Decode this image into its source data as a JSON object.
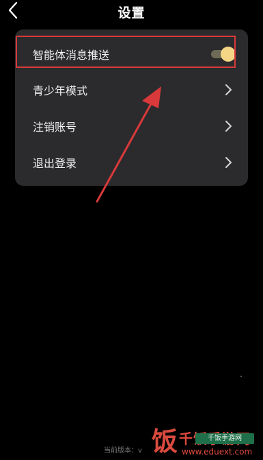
{
  "header": {
    "title": "设置"
  },
  "settings": {
    "items": [
      {
        "label": "智能体消息推送",
        "control": "toggle",
        "toggle_on": true
      },
      {
        "label": "青少年模式",
        "control": "chevron"
      },
      {
        "label": "注销账号",
        "control": "chevron"
      },
      {
        "label": "退出登录",
        "control": "chevron"
      }
    ]
  },
  "footer": {
    "version_text": "当前版本：v"
  },
  "watermark": {
    "char": "饭",
    "title": "千饭手游网",
    "url": "www.eduext.com",
    "badge": "千饭手游网"
  },
  "colors": {
    "background": "#000000",
    "card": "#2b2b2d",
    "toggle_track": "#6f6a55",
    "toggle_knob": "#f4d585",
    "annotation_red": "#d9393a"
  },
  "icons": {
    "back": "chevron-left-icon",
    "row_chevron": "chevron-right-icon"
  }
}
